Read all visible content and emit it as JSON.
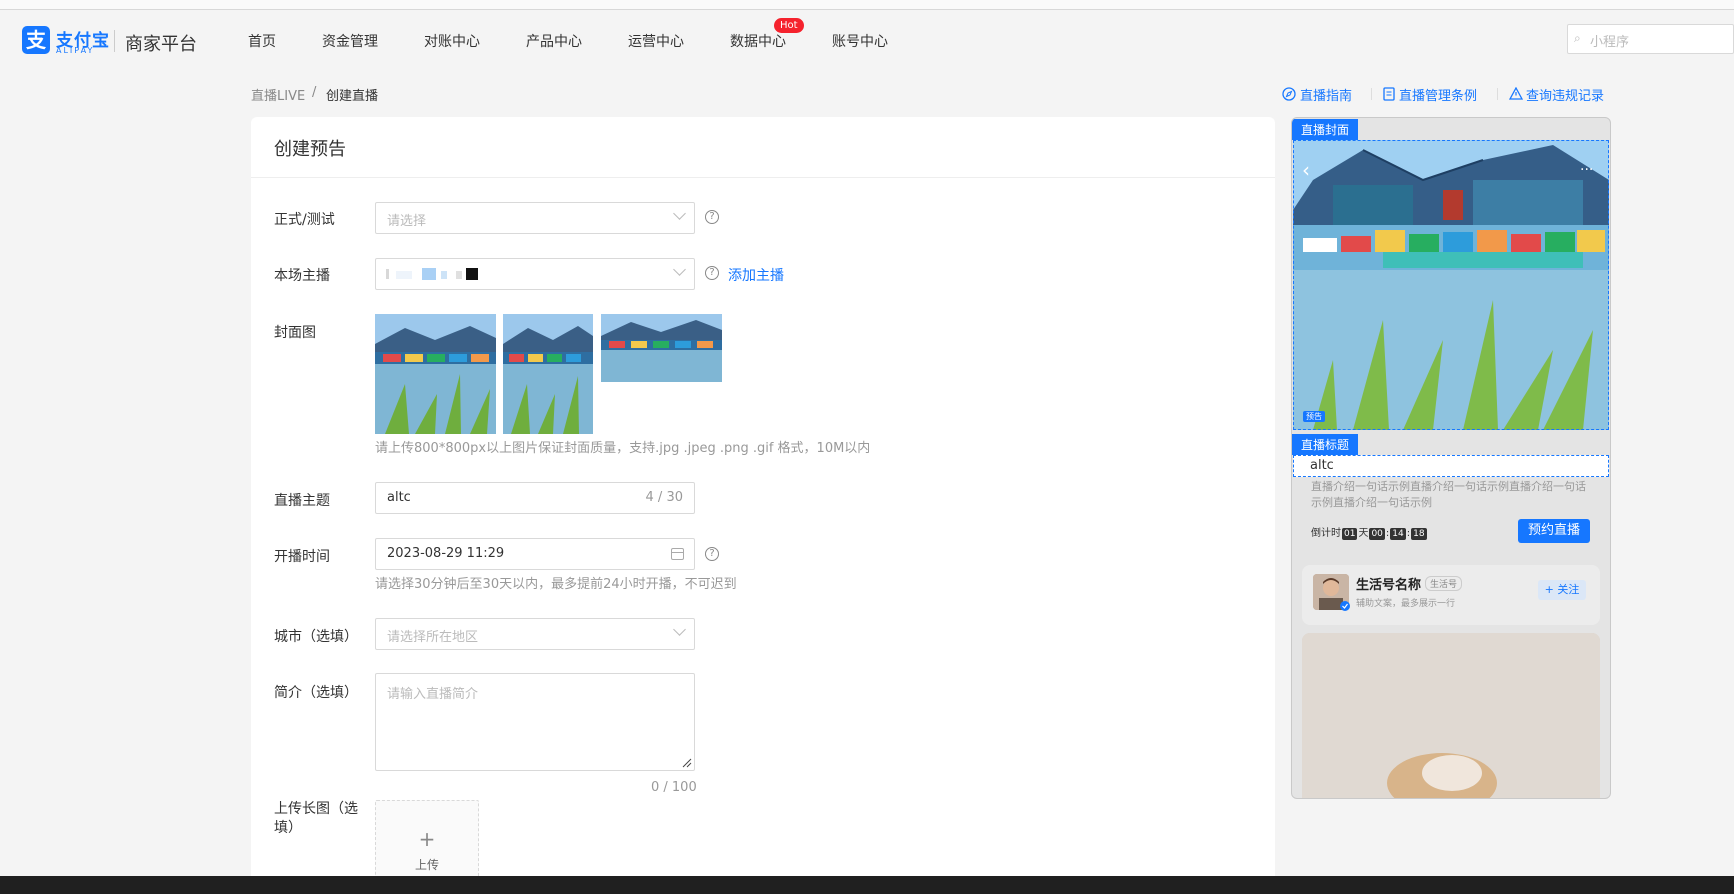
{
  "header": {
    "logo_icon": "支",
    "logo_text": "支付宝",
    "logo_sub": "ALIPAY",
    "platform": "商家平台",
    "nav": [
      "首页",
      "资金管理",
      "对账中心",
      "产品中心",
      "运营中心",
      "数据中心",
      "账号中心"
    ],
    "hot_badge": "Hot",
    "search_placeholder": "小程序"
  },
  "breadcrumb": {
    "parent": "直播LIVE",
    "sep": "/",
    "current": "创建直播"
  },
  "top_links": [
    "直播指南",
    "直播管理条例",
    "查询违规记录"
  ],
  "form": {
    "title": "创建预告",
    "mode": {
      "label": "正式/测试",
      "placeholder": "请选择"
    },
    "anchor": {
      "label": "本场主播",
      "add_link": "添加主播"
    },
    "cover": {
      "label": "封面图",
      "hint": "请上传800*800px以上图片保证封面质量，支持.jpg .jpeg .png .gif 格式，10M以内"
    },
    "topic": {
      "label": "直播主题",
      "value": "altc",
      "counter": "4 / 30"
    },
    "time": {
      "label": "开播时间",
      "value": "2023-08-29 11:29",
      "hint": "请选择30分钟后至30天以内，最多提前24小时开播，不可迟到"
    },
    "city": {
      "label": "城市（选填）",
      "placeholder": "请选择所在地区"
    },
    "intro": {
      "label": "简介（选填）",
      "placeholder": "请输入直播简介",
      "counter": "0 / 100"
    },
    "long_image": {
      "label": "上传长图（选填）",
      "plus": "+",
      "upload": "上传"
    }
  },
  "preview": {
    "cover_tag": "直播封面",
    "back": "‹",
    "more": "···",
    "preview_badge": "预告",
    "title_tag": "直播标题",
    "title_value": "altc",
    "intro": "直播介绍一句话示例直播介绍一句话示例直播介绍一句话示例直播介绍一句话示例",
    "countdown_label": "倒计时",
    "countdown": [
      "01",
      "天",
      "00",
      "14",
      "18"
    ],
    "reserve": "预约直播",
    "life_name": "生活号名称",
    "life_badge": "生活号",
    "life_sub": "辅助文案，最多展示一行",
    "follow": "+ 关注"
  },
  "colors": {
    "accent": "#1677ff",
    "hot": "#f5222d"
  }
}
